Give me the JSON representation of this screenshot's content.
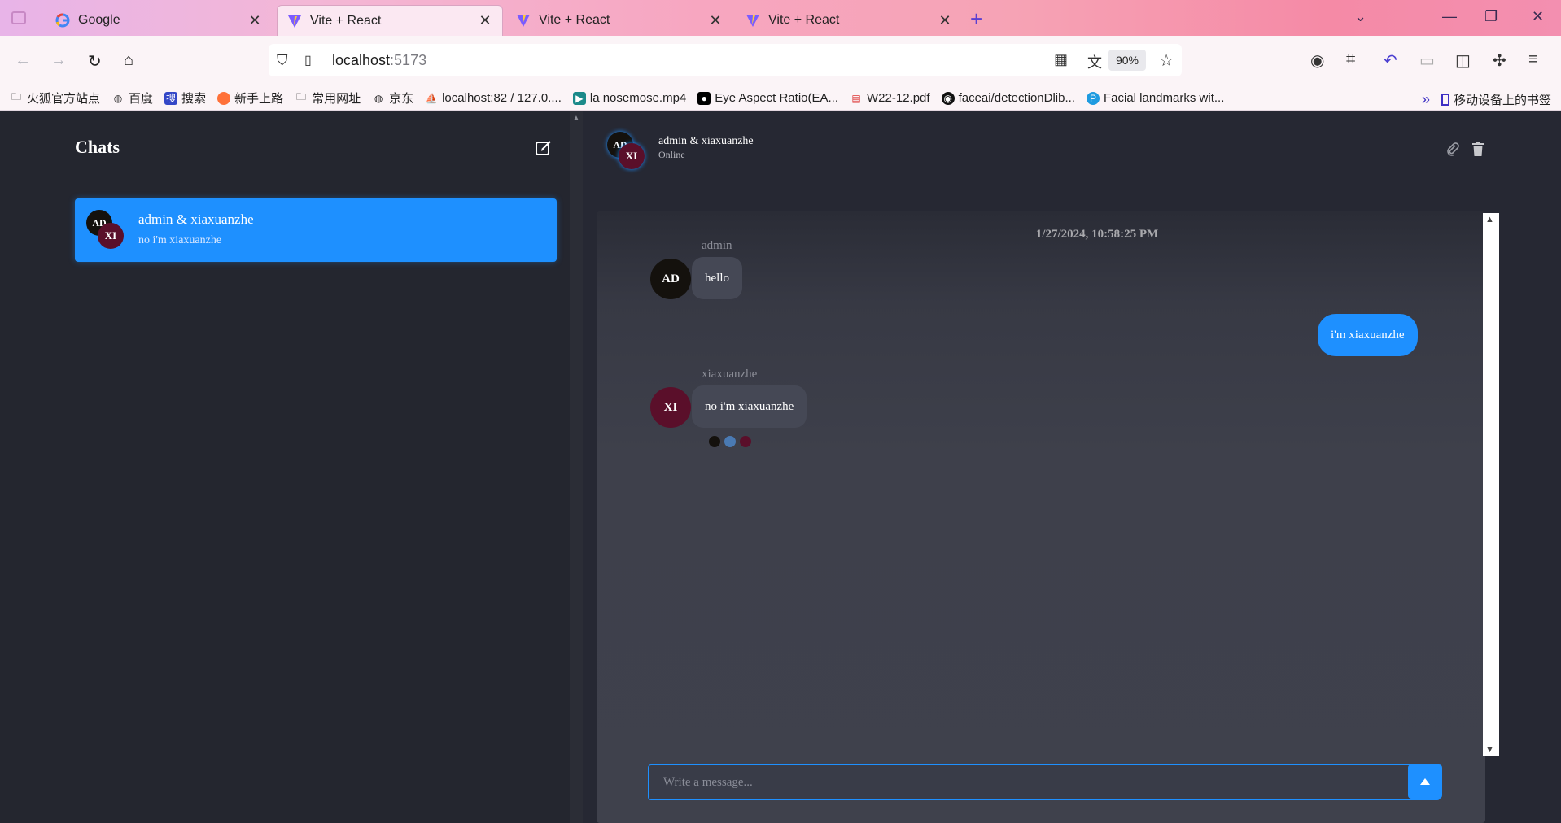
{
  "browser": {
    "tabs": [
      {
        "title": "Google",
        "favicon": "google-icon",
        "active": false
      },
      {
        "title": "Vite + React",
        "favicon": "vite-icon",
        "active": true
      },
      {
        "title": "Vite + React",
        "favicon": "vite-icon",
        "active": false
      },
      {
        "title": "Vite + React",
        "favicon": "vite-icon",
        "active": false
      }
    ],
    "url_host": "localhost",
    "url_port": ":5173",
    "zoom": "90%",
    "bookmarks": [
      {
        "label": "火狐官方站点",
        "icon": "folder-icon"
      },
      {
        "label": "百度",
        "icon": "globe-icon"
      },
      {
        "label": "搜索",
        "icon": "search-site-icon"
      },
      {
        "label": "新手上路",
        "icon": "firefox-icon"
      },
      {
        "label": "常用网址",
        "icon": "folder-icon"
      },
      {
        "label": "京东",
        "icon": "globe-icon"
      },
      {
        "label": "localhost:82 / 127.0....",
        "icon": "phpmyadmin-icon"
      },
      {
        "label": "la nosemose.mp4",
        "icon": "video-icon"
      },
      {
        "label": "Eye Aspect Ratio(EA...",
        "icon": "medium-icon"
      },
      {
        "label": "W22-12.pdf",
        "icon": "pdf-icon"
      },
      {
        "label": "faceai/detectionDlib...",
        "icon": "github-icon"
      },
      {
        "label": "Facial landmarks wit...",
        "icon": "pyimagesearch-icon"
      }
    ],
    "mobile_bookmarks": "移动设备上的书签"
  },
  "sidebar": {
    "title": "Chats",
    "chats": [
      {
        "name": "admin & xiaxuanzhe",
        "last_message": "no i'm xiaxuanzhe",
        "avatars": [
          "AD",
          "XI"
        ]
      }
    ]
  },
  "chat": {
    "header": {
      "name": "admin & xiaxuanzhe",
      "status": "Online",
      "avatars": [
        "AD",
        "XI"
      ]
    },
    "timestamp": "1/27/2024, 10:58:25 PM",
    "messages": [
      {
        "sender": "admin",
        "avatar": "AD",
        "text": "hello",
        "direction": "in"
      },
      {
        "sender": "",
        "avatar": "",
        "text": "i'm xiaxuanzhe",
        "direction": "out"
      },
      {
        "sender": "xiaxuanzhe",
        "avatar": "XI",
        "text": "no i'm xiaxuanzhe",
        "direction": "in"
      }
    ],
    "typing_dot_colors": [
      "#14110d",
      "#4a7ab3",
      "#5a0f2a"
    ],
    "composer_placeholder": "Write a message..."
  },
  "colors": {
    "accent": "#1e90ff",
    "admin_avatar": "#14110d",
    "xi_avatar": "#5a0f2a",
    "background": "#24262f"
  }
}
